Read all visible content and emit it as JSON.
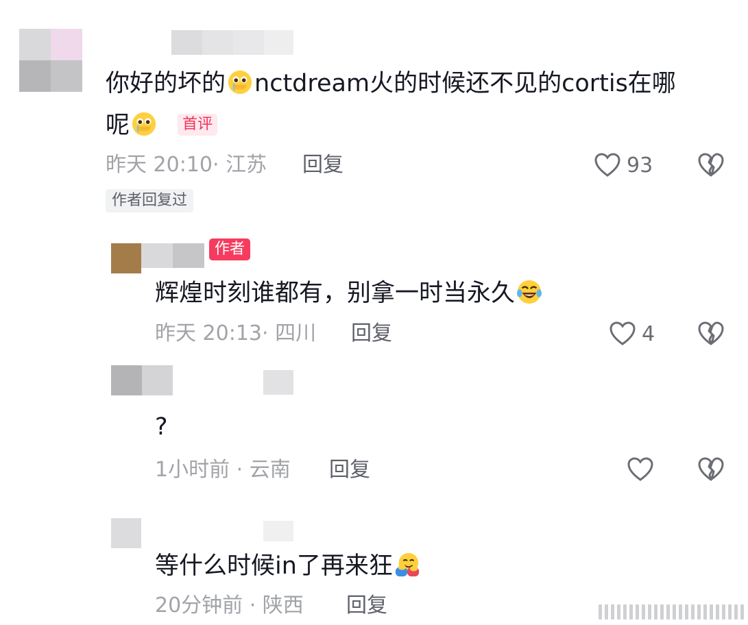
{
  "comments": [
    {
      "text_a": "你好的坏的",
      "emoji_a": "crying-face-emoji",
      "text_b": "nctdream火的时候还不见的cortis在哪",
      "text_c": "呢",
      "emoji_b": "crying-face-emoji",
      "tag": "首评",
      "meta": "昨天 20:10· 江苏",
      "reply_label": "回复",
      "like_count": "93",
      "author_replied": "作者回复过"
    },
    {
      "author_tag": "作者",
      "text": "辉煌时刻谁都有，别拿一时当永久",
      "emoji": "tears-of-joy-emoji",
      "meta": "昨天 20:13· 四川",
      "reply_label": "回复",
      "like_count": "4"
    },
    {
      "text": "?",
      "meta": "1小时前 · 云南",
      "reply_label": "回复",
      "like_count": ""
    },
    {
      "text": "等什么时候in了再来狂",
      "emoji": "hugging-face-emoji",
      "meta": "20分钟前 · 陕西",
      "reply_label": "回复"
    }
  ],
  "colors": {
    "text": "#161823",
    "meta": "#a1a3a8",
    "accent_red": "#f4335a",
    "tag_bg": "#fde9ee"
  },
  "icons": [
    "heart-outline-icon",
    "broken-heart-icon",
    "watermark-bars"
  ]
}
